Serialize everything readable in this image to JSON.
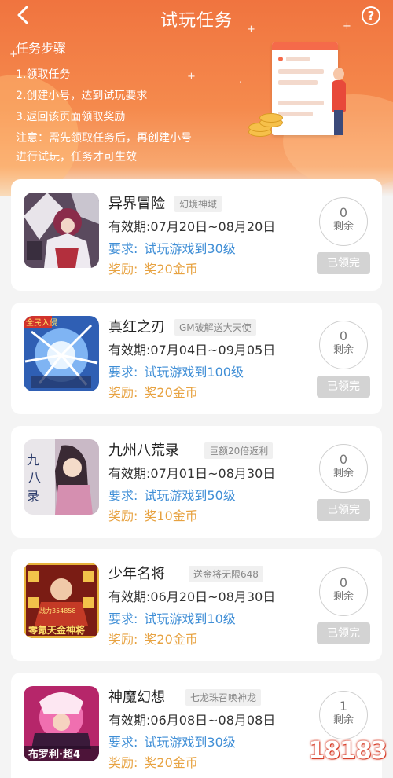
{
  "header": {
    "title": "试玩任务",
    "back_icon": "chevron-left-icon",
    "help_label": "?",
    "steps_title": "任务步骤",
    "steps": [
      "1.领取任务",
      "2.创建小号，达到试玩要求",
      "3.返回该页面领取奖励"
    ],
    "note_line1": "注意：需先领取任务后，再创建小号",
    "note_line2": "进行试玩，任务才可生效"
  },
  "labels": {
    "validity_prefix": "有效期:",
    "requirement_prefix": "要求:",
    "reward_prefix": "奖励:",
    "remaining": "剩余",
    "claimed": "已领完"
  },
  "tasks": [
    {
      "name": "异界冒险",
      "tag": "幻境神域",
      "validity": "07月20日~08月20日",
      "requirement": "试玩游戏到30级",
      "reward": "奖20金币",
      "remaining": "0",
      "button": "已领完"
    },
    {
      "name": "真红之刃",
      "tag": "GM破解送大天使",
      "validity": "07月04日~09月05日",
      "requirement": "试玩游戏到100级",
      "reward": "奖20金币",
      "remaining": "0",
      "button": "已领完"
    },
    {
      "name": "九州八荒录",
      "tag": "巨额20倍返利",
      "validity": "07月01日~08月30日",
      "requirement": "试玩游戏到50级",
      "reward": "奖10金币",
      "remaining": "0",
      "button": "已领完"
    },
    {
      "name": "少年名将",
      "tag": "送金将无限648",
      "validity": "06月20日~08月30日",
      "requirement": "试玩游戏到10级",
      "reward": "奖20金币",
      "remaining": "0",
      "button": "已领完"
    },
    {
      "name": "神魔幻想",
      "tag": "七龙珠召唤神龙",
      "validity": "06月08日~08月08日",
      "requirement": "试玩游戏到30级",
      "reward": "奖20金币",
      "remaining": "1",
      "button": ""
    }
  ],
  "thumb_text": {
    "t2": "全民入侵",
    "t4a": "战力354858",
    "t4b": "零氪天金神将",
    "t5": "布罗利·超4"
  },
  "watermark": "18183",
  "colors": {
    "header_start": "#f0743f",
    "requirement": "#3f8ed6",
    "reward": "#e7a241",
    "claimed_bg": "#d3d3d3"
  }
}
